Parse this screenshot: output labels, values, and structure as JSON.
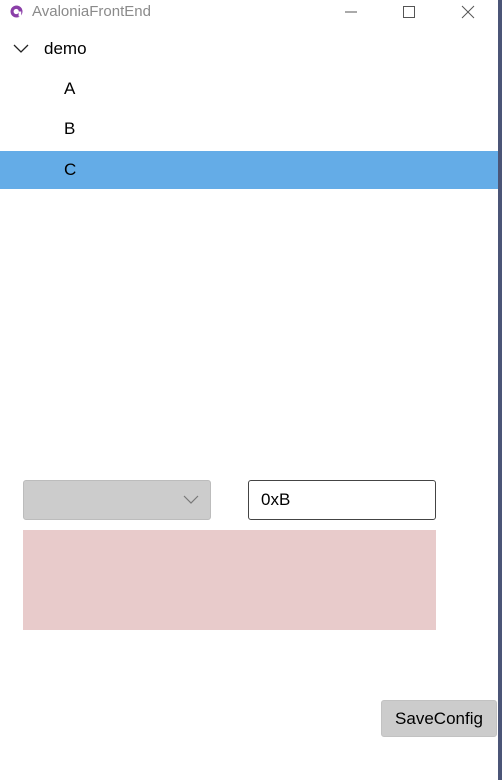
{
  "window": {
    "title": "AvaloniaFrontEnd"
  },
  "tree": {
    "root": {
      "label": "demo",
      "expanded": true
    },
    "children": [
      {
        "label": "A",
        "selected": false
      },
      {
        "label": "B",
        "selected": false
      },
      {
        "label": "C",
        "selected": true
      }
    ]
  },
  "form": {
    "combo_selected": "",
    "address_value": "0xB"
  },
  "toolbar": {
    "save_label": "SaveConfig"
  },
  "colors": {
    "selection": "#64ace7",
    "panel": "#e8cbcb",
    "button": "#cccccc",
    "icon": "#8b3fa8"
  }
}
